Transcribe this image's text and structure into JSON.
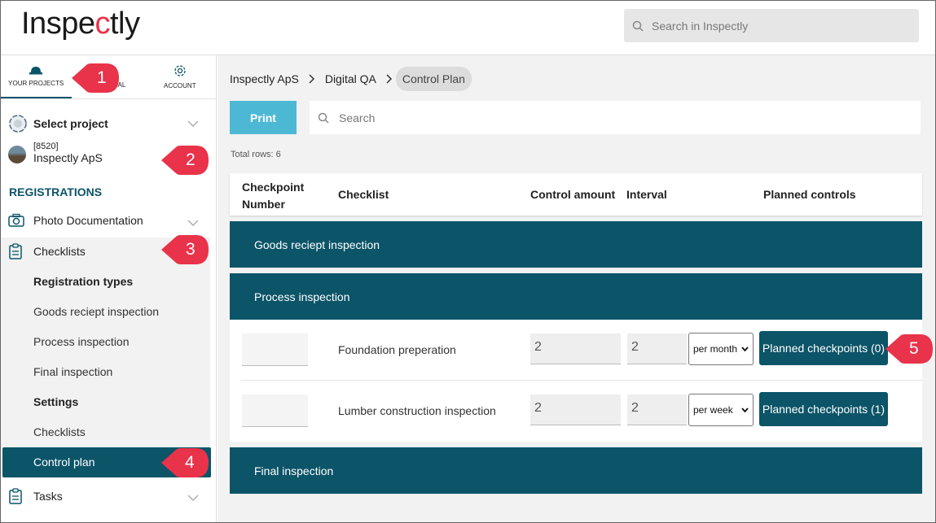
{
  "header": {
    "logo_prefix": "Inspe",
    "logo_accent": "c",
    "logo_suffix": "tly",
    "search_placeholder": "Search in Inspectly"
  },
  "sidebar": {
    "tabs": [
      {
        "label": "YOUR PROJECTS",
        "icon": "hard-hat-icon",
        "active": true
      },
      {
        "label": "PERSONAL",
        "icon": "person-icon",
        "active": false
      },
      {
        "label": "ACCOUNT",
        "icon": "gear-icon",
        "active": false
      }
    ],
    "select_project": "Select project",
    "project_number": "[8520]",
    "project_name": "Inspectly ApS",
    "section_title": "REGISTRATIONS",
    "photo_documentation": "Photo Documentation",
    "checklists": "Checklists",
    "registration_types": "Registration types",
    "goods_receipt": "Goods reciept inspection",
    "process_inspection": "Process inspection",
    "final_inspection": "Final inspection",
    "settings": "Settings",
    "settings_checklists": "Checklists",
    "control_plan": "Control plan",
    "tasks": "Tasks"
  },
  "breadcrumb": [
    "Inspectly ApS",
    "Digital QA",
    "Control Plan"
  ],
  "toolbar": {
    "print_label": "Print",
    "search_placeholder": "Search"
  },
  "total_rows": "Total rows: 6",
  "table": {
    "columns": [
      "Checkpoint Number",
      "Checklist",
      "Control amount",
      "Interval",
      "Planned controls"
    ],
    "groups": [
      "Goods reciept inspection",
      "Process inspection",
      "Final inspection"
    ],
    "rows": [
      {
        "checklist": "Foundation preperation",
        "control_amount": "2",
        "interval": "2",
        "period": "per month",
        "planned": "Planned checkpoints (0)"
      },
      {
        "checklist": "Lumber construction inspection",
        "control_amount": "2",
        "interval": "2",
        "period": "per week",
        "planned": "Planned checkpoints (1)"
      }
    ]
  },
  "callouts": [
    "1",
    "2",
    "3",
    "4",
    "5"
  ],
  "colors": {
    "primary": "#0c5468",
    "print_button": "#4db8d4",
    "callout": "#e8334a"
  }
}
